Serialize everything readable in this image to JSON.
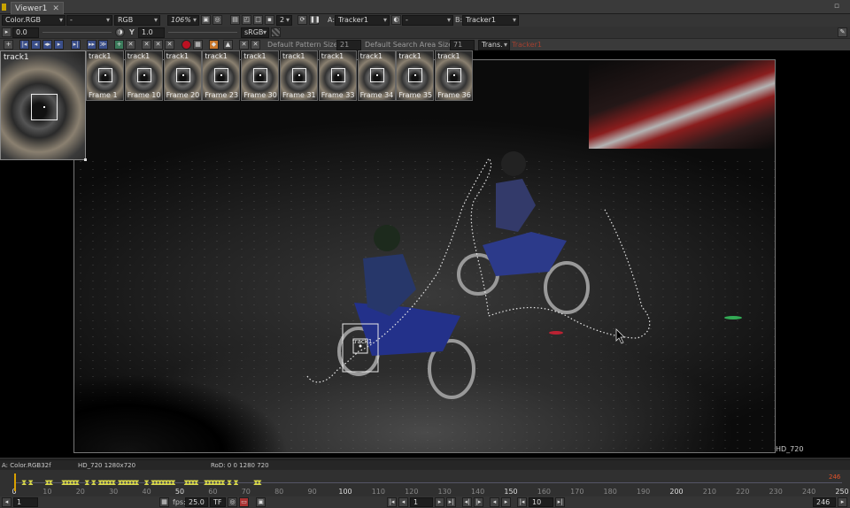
{
  "viewer_tab": {
    "label": "Viewer1",
    "close": "✕"
  },
  "toolbar1": {
    "layer": "Color.RGB",
    "layer2": "-",
    "channels": "RGB",
    "zoom": "106%",
    "proxy_level": "2",
    "input_a_label": "A:",
    "input_a": "Tracker1",
    "input_b_op": "-",
    "input_b_label": "B:",
    "input_b": "Tracker1"
  },
  "toolbar2": {
    "gain": "0.0",
    "gamma_label": "Y",
    "gamma": "1.0",
    "colorspace": "sRGB"
  },
  "tracker_bar": {
    "pattern_label": "Default Pattern Size:",
    "pattern_value": "21",
    "search_label": "Default Search Area Size:",
    "search_value": "71",
    "transform": "Trans.",
    "node": "Tracker1"
  },
  "keyframe_strip": {
    "main_track": "track1",
    "thumbs": [
      {
        "track": "track1",
        "frame": "Frame 1"
      },
      {
        "track": "track1",
        "frame": "Frame 10"
      },
      {
        "track": "track1",
        "frame": "Frame 20"
      },
      {
        "track": "track1",
        "frame": "Frame 23"
      },
      {
        "track": "track1",
        "frame": "Frame 30"
      },
      {
        "track": "track1",
        "frame": "Frame 31"
      },
      {
        "track": "track1",
        "frame": "Frame 33"
      },
      {
        "track": "track1",
        "frame": "Frame 34"
      },
      {
        "track": "track1",
        "frame": "Frame 35"
      },
      {
        "track": "track1",
        "frame": "Frame 36"
      }
    ]
  },
  "viewer": {
    "format": "HD_720",
    "track_label": "track1"
  },
  "infobar": {
    "channel_info": "A: Color.RGB32f",
    "format_info": "HD_720 1280x720",
    "rod_info": "RoD: 0 0 1280 720"
  },
  "timeline": {
    "ticks": [
      "0",
      "10",
      "20",
      "30",
      "40",
      "50",
      "60",
      "70",
      "80",
      "90",
      "100",
      "110",
      "120",
      "130",
      "140",
      "150",
      "160",
      "170",
      "180",
      "190",
      "200",
      "210",
      "220",
      "230",
      "240",
      "250"
    ],
    "major_ticks": [
      "0",
      "50",
      "100",
      "150",
      "200",
      "250"
    ],
    "keyframes": [
      3,
      5,
      10,
      11,
      15,
      16,
      17,
      18,
      19,
      22,
      24,
      26,
      27,
      28,
      29,
      30,
      32,
      33,
      34,
      35,
      36,
      37,
      40,
      42,
      43,
      44,
      45,
      46,
      47,
      48,
      52,
      53,
      54,
      55,
      58,
      59,
      60,
      61,
      62,
      63,
      65,
      67,
      73,
      74
    ],
    "current_frame": 1,
    "end_marker": "246",
    "range_end": "250"
  },
  "playback": {
    "current_frame": "1",
    "fps_label": "fps:",
    "fps": "25.0",
    "tf": "TF",
    "step": "10",
    "last_frame": "246"
  },
  "colors": {
    "keyframe": "#d8d84a",
    "playhead": "#d9a000",
    "end_marker": "#e0522a",
    "track_path": "#e8e8e8"
  }
}
